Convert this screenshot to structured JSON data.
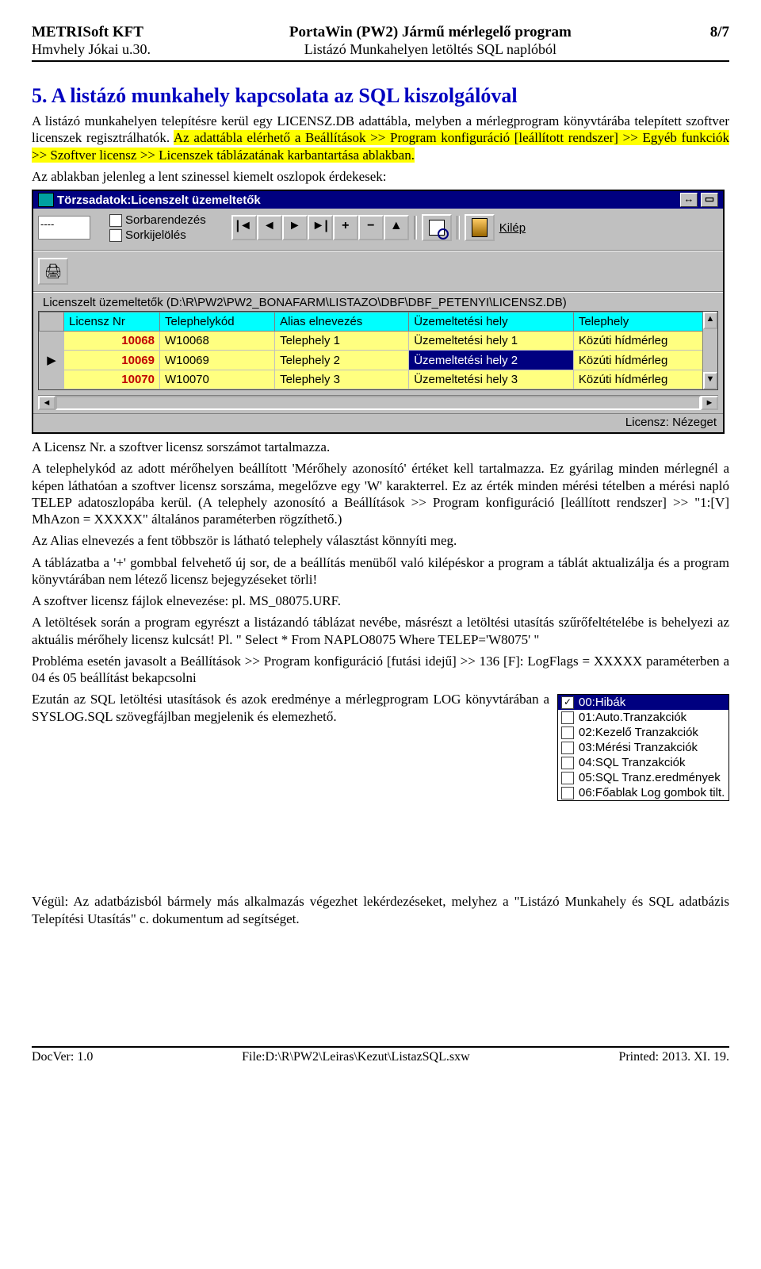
{
  "header": {
    "company": "METRISoft KFT",
    "address": "Hmvhely Jókai u.30.",
    "appTitle": "PortaWin (PW2) Jármű mérlegelő program",
    "subtitle": "Listázó Munkahelyen letöltés SQL naplóból",
    "page": "8/7"
  },
  "section": {
    "title": "5. A listázó munkahely kapcsolata az SQL kiszolgálóval",
    "p1a": "A listázó munkahelyen telepítésre kerül egy LICENSZ.DB adattábla, melyben a mérlegprogram könyvtárába telepített szoftver licenszek regisztrálhatók. ",
    "p1b": "Az adattábla elérhető a Beállítások >> Program konfiguráció [leállított rendszer] >> Egyéb funkciók >> Szoftver licensz >> Licenszek táblázatának karbantartása ablakban.",
    "p2": "Az ablakban jelenleg a lent szinessel kiemelt oszlopok érdekesek:"
  },
  "win": {
    "title": "Törzsadatok:Licenszelt üzemeltetők",
    "dash": "----",
    "chk1": "Sorbarendezés",
    "chk2": "Sorkijelölés",
    "exitLabel": "Kilép",
    "groupLabel": "Licenszelt üzemeltetők (D:\\R\\PW2\\PW2_BONAFARM\\LISTAZO\\DBF\\DBF_PETENYI\\LICENSZ.DB)",
    "cols": [
      "Licensz Nr",
      "Telephelykód",
      "Alias elnevezés",
      "Üzemeltetési hely",
      "Telephely"
    ],
    "rows": [
      {
        "marker": "",
        "nr": "10068",
        "kod": "W10068",
        "alias": "Telephely 1",
        "uzem": "Üzemeltetési hely 1",
        "tel": "Közúti hídmérleg",
        "sel": false
      },
      {
        "marker": "▶",
        "nr": "10069",
        "kod": "W10069",
        "alias": "Telephely 2",
        "uzem": "Üzemeltetési hely 2",
        "tel": "Közúti hídmérleg",
        "sel": true
      },
      {
        "marker": "",
        "nr": "10070",
        "kod": "W10070",
        "alias": "Telephely 3",
        "uzem": "Üzemeltetési hely 3",
        "tel": "Közúti hídmérleg",
        "sel": false
      }
    ],
    "status": "Licensz: Nézeget"
  },
  "after": {
    "p3": "A Licensz Nr. a szoftver licensz sorszámot tartalmazza.",
    "p4": "A telephelykód az adott mérőhelyen beállított 'Mérőhely azonosító' értéket kell tartalmazza. Ez gyárilag minden mérlegnél a képen láthatóan a szoftver licensz sorszáma, megelőzve egy 'W' karakterrel. Ez az érték minden mérési tételben a mérési napló TELEP adatoszlopába kerül. (A telephely azonosító a Beállítások >> Program konfiguráció [leállított rendszer] >> \"1:[V] MhAzon = XXXXX\" általános paraméterben rögzíthető.)",
    "p5": "Az Alias elnevezés a fent többször is látható telephely választást könnyíti meg.",
    "p6": "A táblázatba a '+' gombbal felvehető új sor, de a beállítás menüből való kilépéskor a program a táblát aktualizálja és a program könyvtárában nem létező licensz bejegyzéseket törli!",
    "p7": "A szoftver licensz fájlok elnevezése: pl. MS_08075.URF.",
    "p8": "A letöltések során a program egyrészt a listázandó táblázat nevébe, másrészt a letöltési utasítás szűrőfeltételébe is behelyezi az aktuális mérőhely licensz kulcsát! Pl.  \" Select * From NAPLO8075 Where TELEP='W8075' \"",
    "p9": "Probléma esetén javasolt a Beállítások >> Program konfiguráció [futási idejű] >> 136 [F]: LogFlags = XXXXX paraméterben a 04 és 05 beállítást bekapcsolni",
    "p10": "Ezután az SQL letöltési utasítások és azok eredménye a mérlegprogram LOG könyvtárában a SYSLOG.SQL szövegfájlban megjelenik és elemezhető.",
    "p11": "Végül: Az adatbázisból bármely más alkalmazás végezhet lekérdezéseket, melyhez a \"Listázó Munkahely és SQL adatbázis Telepítési Utasítás\" c. dokumentum ad segítséget."
  },
  "logopts": {
    "items": [
      {
        "label": "00:Hibák",
        "checked": true,
        "sel": true
      },
      {
        "label": "01:Auto.Tranzakciók",
        "checked": false,
        "sel": false
      },
      {
        "label": "02:Kezelő Tranzakciók",
        "checked": false,
        "sel": false
      },
      {
        "label": "03:Mérési Tranzakciók",
        "checked": false,
        "sel": false
      },
      {
        "label": "04:SQL Tranzakciók",
        "checked": false,
        "sel": false
      },
      {
        "label": "05:SQL Tranz.eredmények",
        "checked": false,
        "sel": false
      },
      {
        "label": "06:Főablak Log gombok tilt.",
        "checked": false,
        "sel": false
      }
    ]
  },
  "footer": {
    "left": "DocVer: 1.0",
    "center": "File:D:\\R\\PW2\\Leiras\\Kezut\\ListazSQL.sxw",
    "right": "Printed: 2013. XI. 19."
  }
}
